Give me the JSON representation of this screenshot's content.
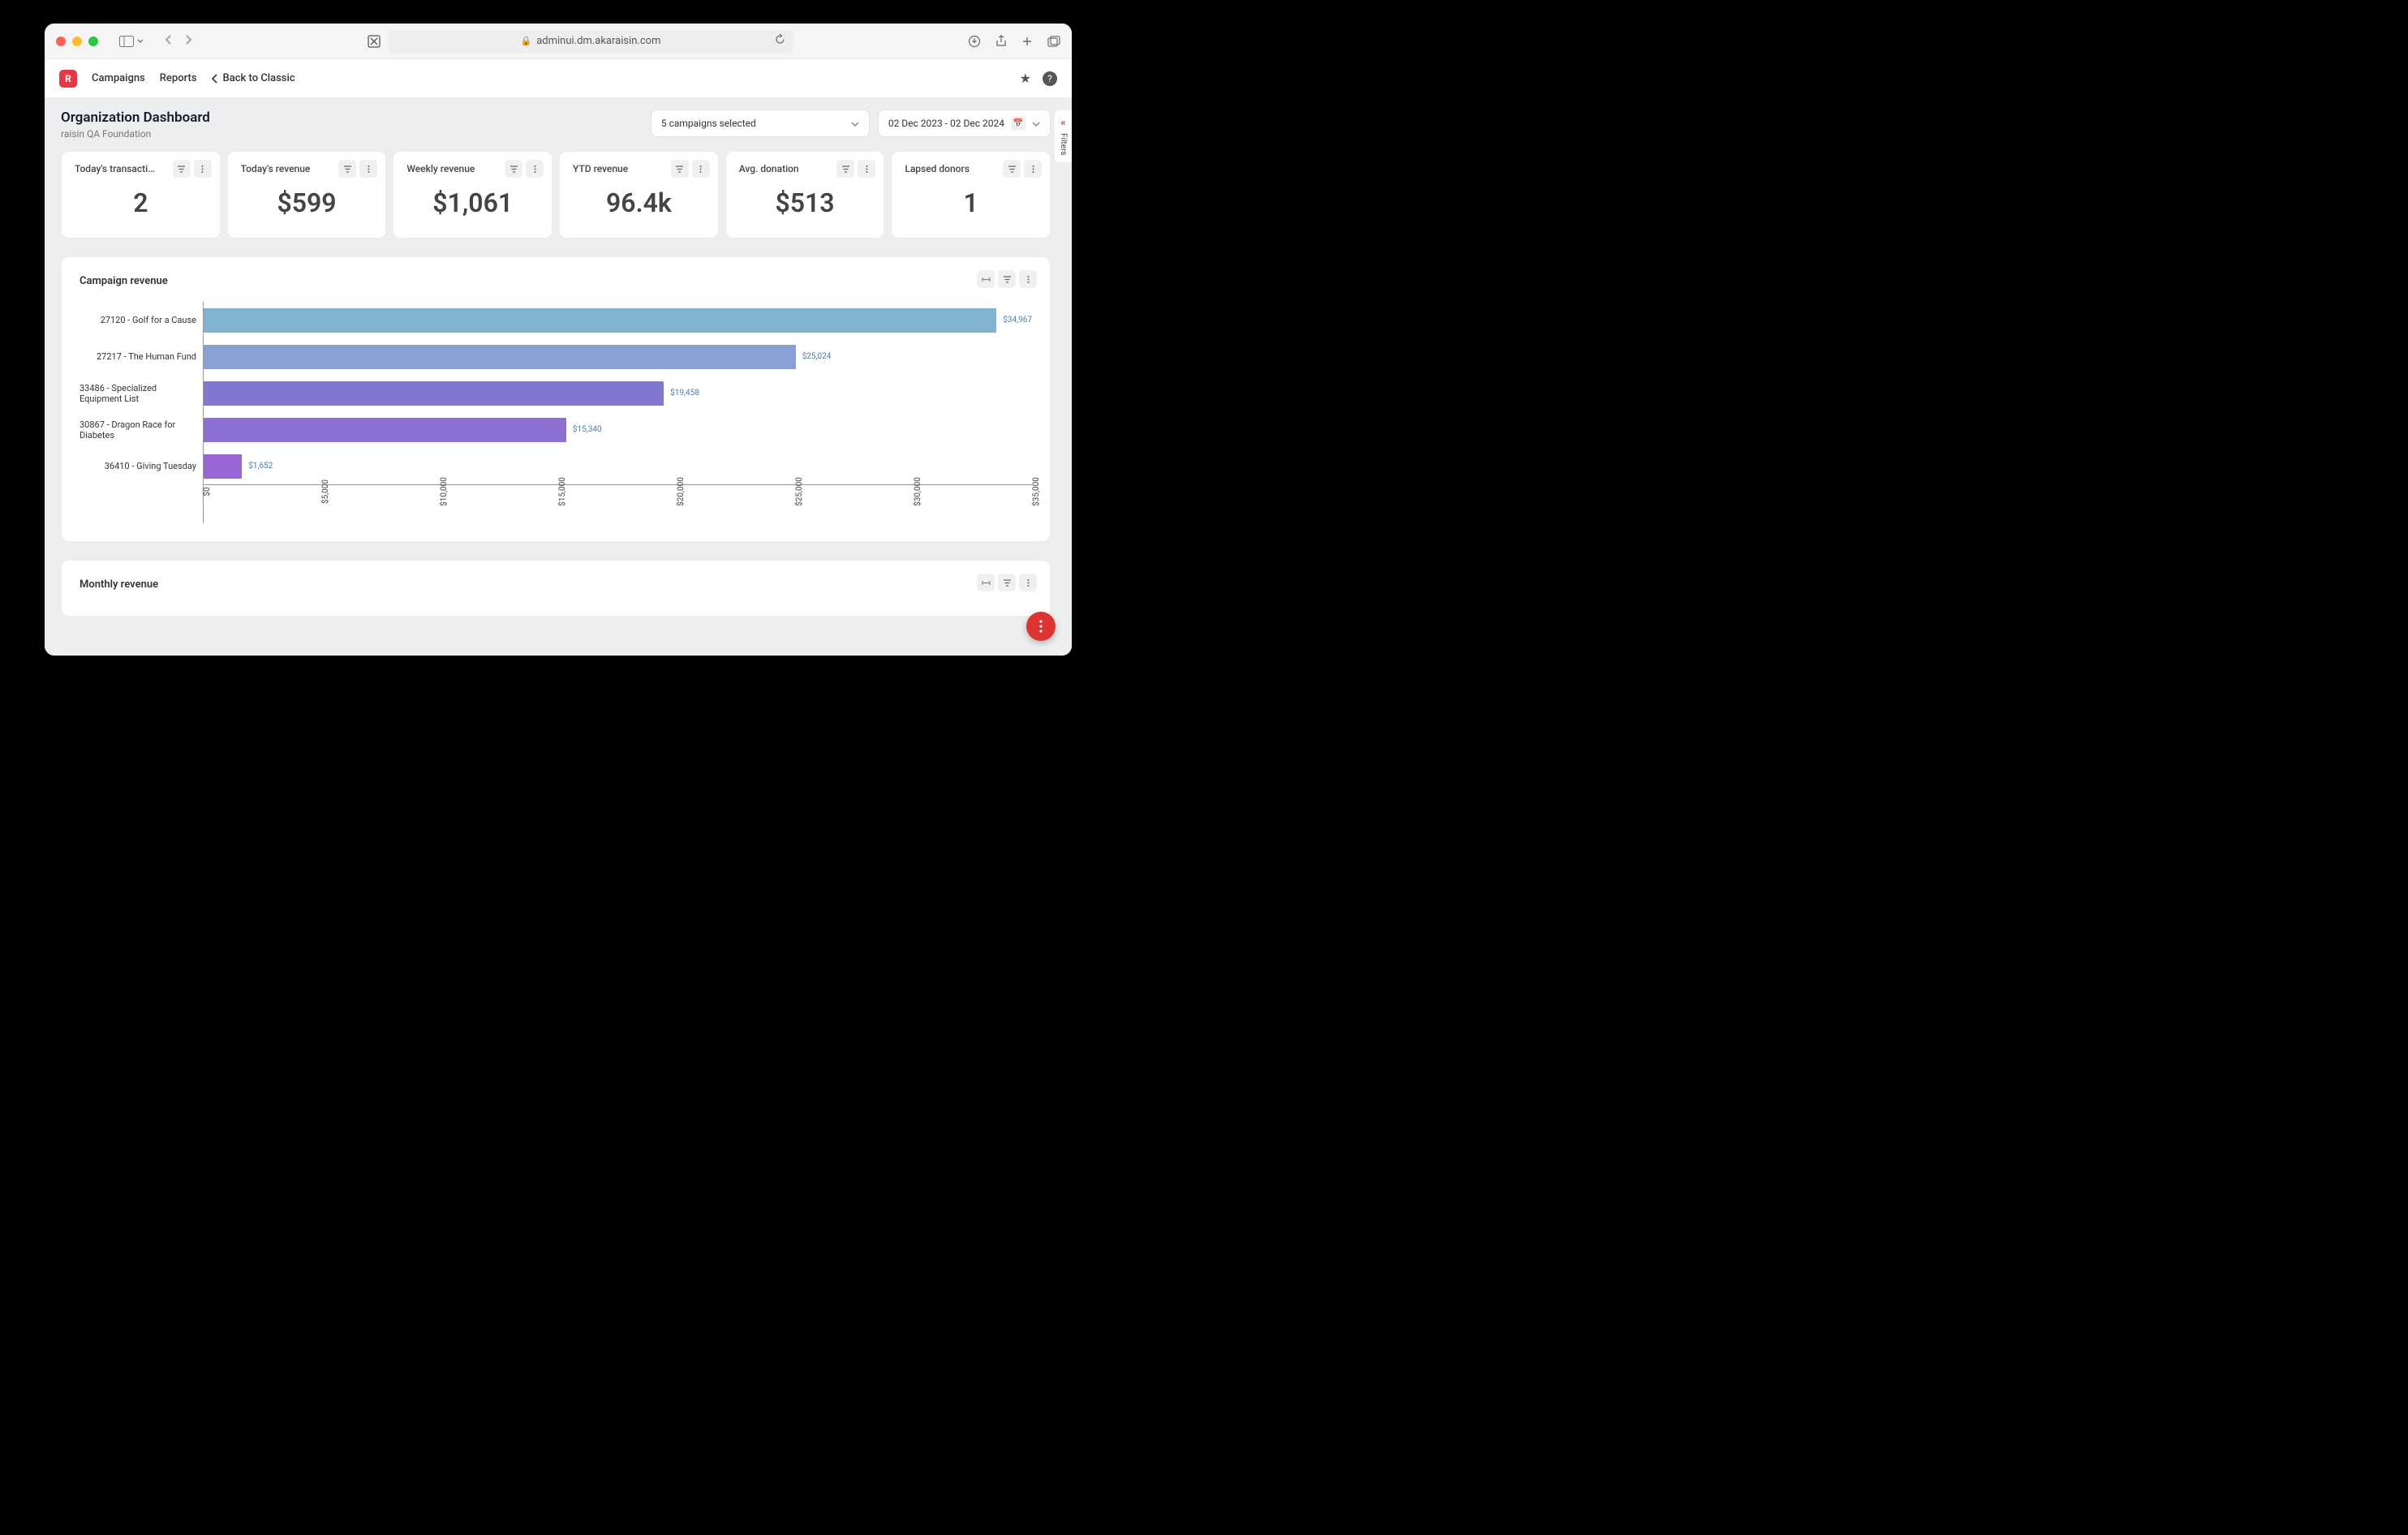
{
  "browser": {
    "url": "adminui.dm.akaraisin.com"
  },
  "header": {
    "nav": {
      "campaigns": "Campaigns",
      "reports": "Reports",
      "back": "Back to Classic"
    }
  },
  "page": {
    "title": "Organization Dashboard",
    "subtitle": "raisin QA Foundation",
    "campaign_selector": "5 campaigns selected",
    "date_range": "02 Dec 2023 - 02 Dec 2024"
  },
  "kpis": [
    {
      "label": "Today's transactio…",
      "value": "2"
    },
    {
      "label": "Today's revenue",
      "value": "$599"
    },
    {
      "label": "Weekly revenue",
      "value": "$1,061"
    },
    {
      "label": "YTD revenue",
      "value": "96.4k"
    },
    {
      "label": "Avg. donation",
      "value": "$513"
    },
    {
      "label": "Lapsed donors",
      "value": "1"
    }
  ],
  "cards": {
    "campaign_revenue": {
      "title": "Campaign revenue"
    },
    "monthly_revenue": {
      "title": "Monthly revenue"
    }
  },
  "filters_label": "Filters",
  "chart_data": {
    "type": "bar",
    "orientation": "horizontal",
    "title": "Campaign revenue",
    "xlabel": "",
    "ylabel": "",
    "xlim": [
      0,
      35000
    ],
    "x_ticks": [
      "$0",
      "$5,000",
      "$10,000",
      "$15,000",
      "$20,000",
      "$25,000",
      "$30,000",
      "$35,000"
    ],
    "categories": [
      "27120 - Golf for a Cause",
      "27217 - The Human Fund",
      "33486 - Specialized Equipment List",
      "30867 - Dragon Race for Diabetes",
      "36410 - Giving Tuesday"
    ],
    "values": [
      34967,
      25024,
      19458,
      15340,
      1652
    ],
    "value_labels": [
      "$34,967",
      "$25,024",
      "$19,458",
      "$15,340",
      "$1,652"
    ],
    "colors": [
      "#7fb3cf",
      "#8a9fd4",
      "#8077d1",
      "#8d6fd4",
      "#9a66d6"
    ]
  }
}
